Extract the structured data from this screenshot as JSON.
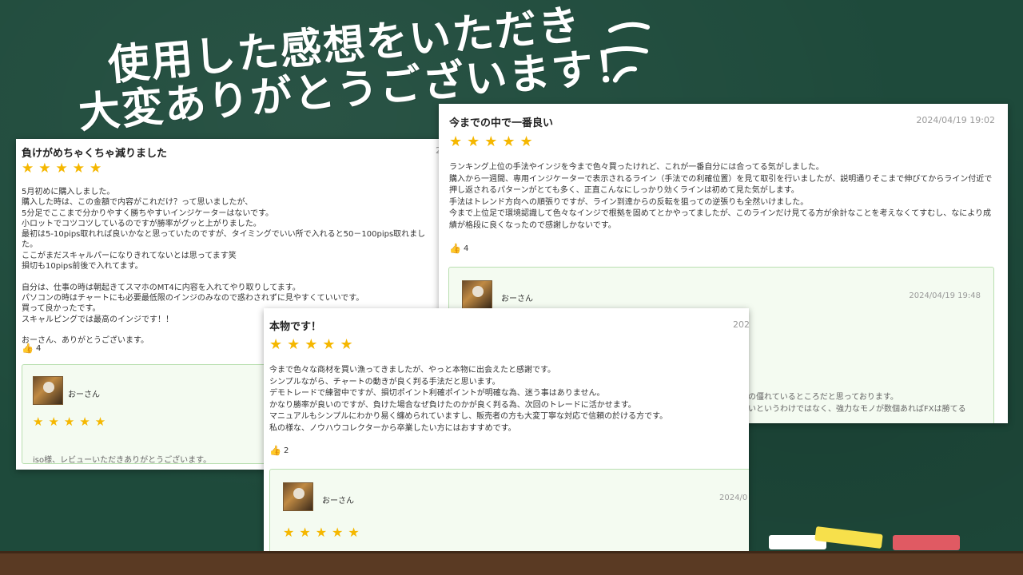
{
  "headline": {
    "line1": "使用した感想をいただき",
    "line2": "大変ありがとうございます！"
  },
  "colors": {
    "board": "#1e4a3b",
    "star": "#f5b700",
    "reply_bg": "#f4fbf1",
    "chalk_white": "#ffffff",
    "chalk_yellow": "#f7e04b",
    "chalk_red": "#e05a63"
  },
  "review_left": {
    "title": "負けがめちゃくちゃ減りました",
    "date": "2",
    "stars": "★★★★★",
    "body": "5月初めに購入しました。\n購入した時は、この金額で内容がこれだけ？って思いましたが、\n5分足でここまで分かりやすく勝ちやすいインジケーターはないです。\n小ロットでコツコツしているのですが勝率がグッと上がりました。\n最初は5-10pips取れれば良いかなと思っていたのですが、タイミングでいい所で入れると50－100pips取れました。\nここがまだスキャルパーになりきれてないとは思ってます笑\n損切も10pips前後で入れてます。\n\n自分は、仕事の時は朝起きてスマホのMT4に内容を入れてやり取りしてます。\nパソコンの時はチャートにも必要最低限のインジのみなので惑わされずに見やすくていいです。\n買って良かったです。\nスキャルピングでは最高のインジです！！\n\nおーさん、ありがとうございます。",
    "likes": "4",
    "reply": {
      "name": "おーさん",
      "stars": "★★★★★",
      "text": "iso様、レビューいただきありがとうございます。"
    }
  },
  "review_right": {
    "title": "今までの中で一番良い",
    "date": "2024/04/19 19:02",
    "stars": "★★★★★",
    "body": "ランキング上位の手法やインジを今まで色々買ったけれど、これが一番自分には合ってる気がしました。\n購入から一週間、専用インジケーターで表示されるライン（手法での利確位置）を見て取引を行いましたが、説明通りそこまで伸びてからライン付近で押し返されるパターンがとても多く、正直こんなにしっかり効くラインは初めて見た気がします。\n手法はトレンド方向への順張りですが、ライン到達からの反転を狙っての逆張りも全然いけました。\n今まで上位足で環境認識して色々なインジで根拠を固めてとかやってましたが、このラインだけ見てる方が余計なことを考えなくてすむし、なにより成績が格段に良くなったので感謝しかないです。",
    "likes": "4",
    "reply": {
      "name": "おーさん",
      "date": "2024/04/19 19:48",
      "text1": "の僵れているところだと思っております。",
      "text2": "いというわけではなく、強力なモノが数個あればFXは勝てる"
    }
  },
  "review_center": {
    "title": "本物です！",
    "date": "202",
    "stars": "★★★★★",
    "body": "今まで色々な商材を買い漁ってきましたが、やっと本物に出会えたと感謝です。\nシンプルながら、チャートの動きが良く判る手法だと思います。\nデモトレードで練習中ですが、損切ポイント利確ポイントが明確な為、迷う事はありません。\nかなり勝率が良いのですが、負けた場合なぜ負けたのかが良く判る為、次回のトレードに活かせます。\nマニュアルもシンプルにわかり易く纏められていますし、販売者の方も大変丁寧な対応で信頼の於ける方です。\n私の様な、ノウハウコレクターから卒業したい方にはおすすめです。",
    "likes": "2",
    "reply": {
      "name": "おーさん",
      "date": "2024/0",
      "stars": "★★★★★"
    }
  }
}
